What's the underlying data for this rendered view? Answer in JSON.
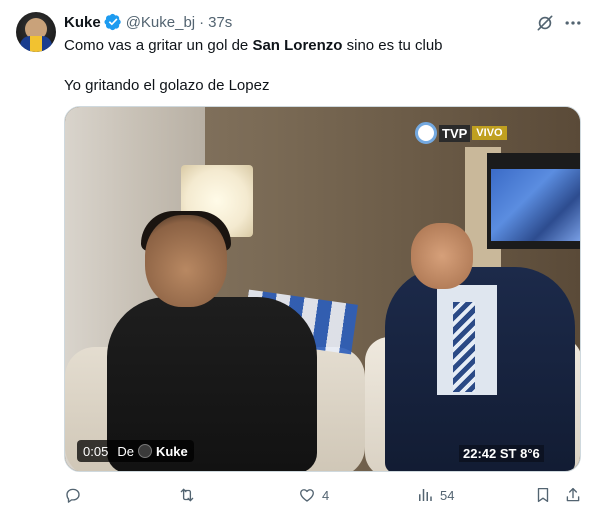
{
  "tweet": {
    "author_name": "Kuke",
    "author_handle": "@Kuke_bj",
    "separator": "·",
    "time": "37s",
    "text_line1_pre": "Como vas a gritar un gol de ",
    "text_line1_bold": "San Lorenzo",
    "text_line1_post": " sino es tu club",
    "text_line2": "Yo gritando el golazo de Lopez"
  },
  "media": {
    "video_time": "0:05",
    "from_label": "De",
    "from_user": "Kuke",
    "overlay_channel": "TVP",
    "overlay_live": "VIVO",
    "overlay_clock": "22:42 ST 8°6"
  },
  "actions": {
    "replies": "",
    "retweets": "",
    "likes": "4",
    "views": "54"
  },
  "colors": {
    "verified": "#1d9bf0",
    "secondary_text": "#536471",
    "primary_text": "#0f1419"
  },
  "icons": [
    "verified-icon",
    "grok-icon",
    "more-icon",
    "reply-icon",
    "retweet-icon",
    "like-icon",
    "views-icon",
    "bookmark-icon",
    "share-icon"
  ]
}
